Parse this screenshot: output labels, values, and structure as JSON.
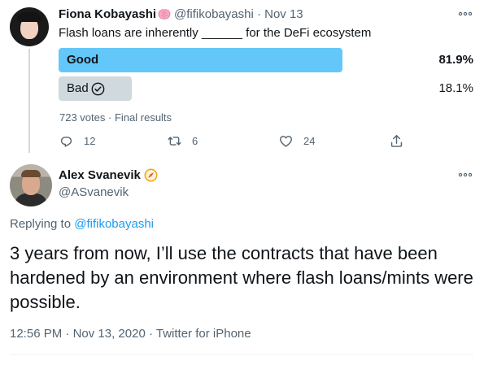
{
  "poll_tweet": {
    "author_name": "Fiona Kobayashi",
    "author_emoji_icon": "brain-icon",
    "author_handle": "@fifikobayashi",
    "separator": "·",
    "date": "Nov 13",
    "text": "Flash loans are inherently ______ for the DeFi ecosystem",
    "poll": {
      "options": [
        {
          "label": "Good",
          "percent_text": "81.9%",
          "share": 0.819,
          "leading": true
        },
        {
          "label": "Bad",
          "percent_text": "18.1%",
          "share": 0.181,
          "voted": true,
          "icon": "check-circle-icon"
        }
      ],
      "votes_text": "723 votes",
      "status_text": "Final results"
    },
    "actions": {
      "replies": "12",
      "retweets": "6",
      "likes": "24"
    }
  },
  "reply_tweet": {
    "author_name": "Alex Svanevik",
    "author_emoji_icon": "compass-icon",
    "author_handle": "@ASvanevik",
    "replying_prefix": "Replying to ",
    "replying_to": "@fifikobayashi",
    "text": "3 years from now, I’ll use the contracts that have been hardened by an environment where flash loans/mints were possible.",
    "time": "12:56 PM",
    "date": "Nov 13, 2020",
    "source": "Twitter for iPhone"
  },
  "colors": {
    "accent": "#1d9bf0",
    "poll_leading_bar": "#64c7f9",
    "poll_other_bar": "#cfd9de",
    "secondary_text": "#536471"
  }
}
